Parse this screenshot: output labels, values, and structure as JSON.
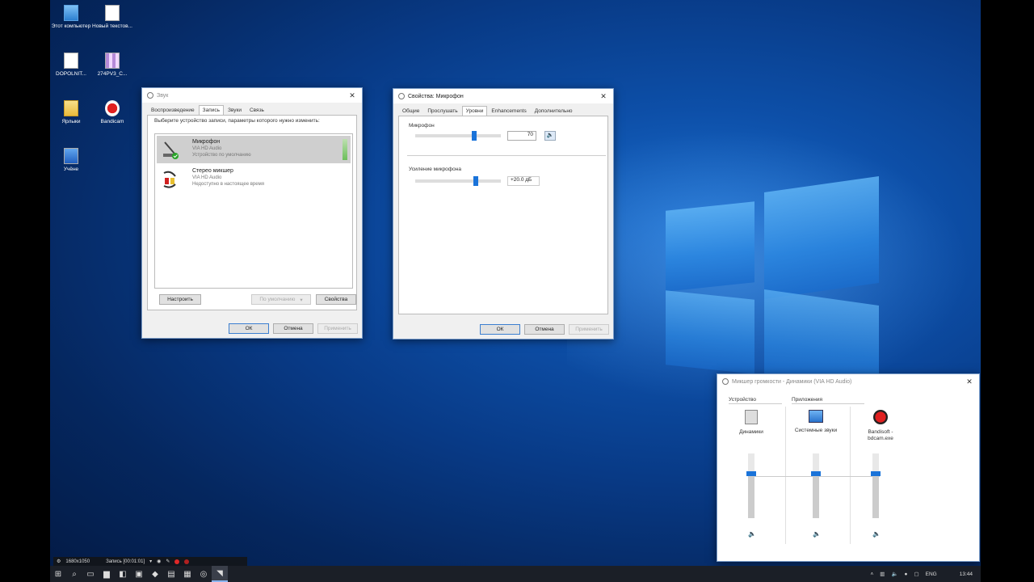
{
  "desktop_icons": [
    {
      "label": "Этот компьютер",
      "icon": "computer-icon"
    },
    {
      "label": "Новый текстов...",
      "icon": "text-document-icon"
    },
    {
      "label": "DOPOLNIT...",
      "icon": "document-icon"
    },
    {
      "label": "274PV3_C...",
      "icon": "archive-icon"
    },
    {
      "label": "Ярлыки",
      "icon": "folder-icon"
    },
    {
      "label": "Bandicam",
      "icon": "bandicam-icon"
    },
    {
      "label": "Учёне",
      "icon": "runner-icon"
    }
  ],
  "sound_window": {
    "title": "Звук",
    "tabs": [
      "Воспроизведение",
      "Запись",
      "Звуки",
      "Связь"
    ],
    "active_tab": "Запись",
    "instruction": "Выберите устройство записи, параметры которого нужно изменить:",
    "devices": [
      {
        "name": "Микрофон",
        "driver": "VIA HD Audio",
        "status": "Устройство по умолчанию",
        "icon": "microphone-icon",
        "selected": true
      },
      {
        "name": "Стерео микшер",
        "driver": "VIA HD Audio",
        "status": "Недоступно в настоящее время",
        "icon": "stereo-mixer-icon",
        "selected": false
      }
    ],
    "buttons": {
      "configure": "Настроить",
      "default": "По умолчанию",
      "properties": "Свойства",
      "ok": "ОК",
      "cancel": "Отмена",
      "apply": "Применить"
    }
  },
  "mic_props_window": {
    "title": "Свойства: Микрофон",
    "tabs": [
      "Общие",
      "Прослушать",
      "Уровни",
      "Enhancements",
      "Дополнительно"
    ],
    "active_tab": "Уровни",
    "mic_label": "Микрофон",
    "mic_level": 70,
    "mic_value": "70",
    "boost_label": "Усиление микрофона",
    "boost_value": "+20.0 дБ",
    "buttons": {
      "ok": "ОК",
      "cancel": "Отмена",
      "apply": "Применить"
    }
  },
  "mixer_window": {
    "title": "Микшер громкости - Динамики (VIA HD Audio)",
    "section_device": "Устройство",
    "section_apps": "Приложения",
    "channels": [
      {
        "label": "Динамики",
        "icon": "speaker-icon",
        "level": 0.7
      },
      {
        "label": "Системные звуки",
        "icon": "system-sounds-icon",
        "level": 0.7
      },
      {
        "label": "Bandisoft - bdcam.exe",
        "icon": "bandicam-icon",
        "level": 0.7
      }
    ]
  },
  "recording_bar": {
    "resolution": "1680x1050",
    "status": "Запись [00:01:01]"
  },
  "taskbar": {
    "lang": "ENG",
    "time": "13:44"
  }
}
